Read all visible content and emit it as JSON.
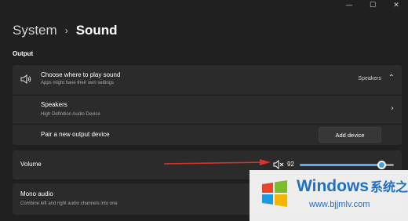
{
  "window": {
    "minimize_glyph": "—",
    "maximize_glyph": "☐",
    "close_glyph": "✕"
  },
  "breadcrumb": {
    "parent": "System",
    "separator": "›",
    "current": "Sound"
  },
  "output": {
    "section_label": "Output",
    "choose": {
      "title": "Choose where to play sound",
      "subtitle": "Apps might have their own settings",
      "selected": "Speakers",
      "icon": "speaker-icon"
    },
    "device": {
      "title": "Speakers",
      "subtitle": "High Definition Audio Device"
    },
    "pair": {
      "title": "Pair a new output device",
      "button_label": "Add device"
    },
    "volume": {
      "label": "Volume",
      "value_text": "92",
      "level": 92,
      "icon": "mute-icon"
    },
    "mono": {
      "title": "Mono audio",
      "subtitle": "Combine left and right audio channels into one"
    }
  },
  "watermark": {
    "brand": "Windows",
    "brand_cn": "系统之家",
    "url": "www.bjjmlv.com"
  },
  "colors": {
    "background": "#202020",
    "card": "#2b2b2b",
    "accent": "#5aaee8",
    "arrow": "#e0302a",
    "watermark_blue": "#1f6fc2"
  }
}
